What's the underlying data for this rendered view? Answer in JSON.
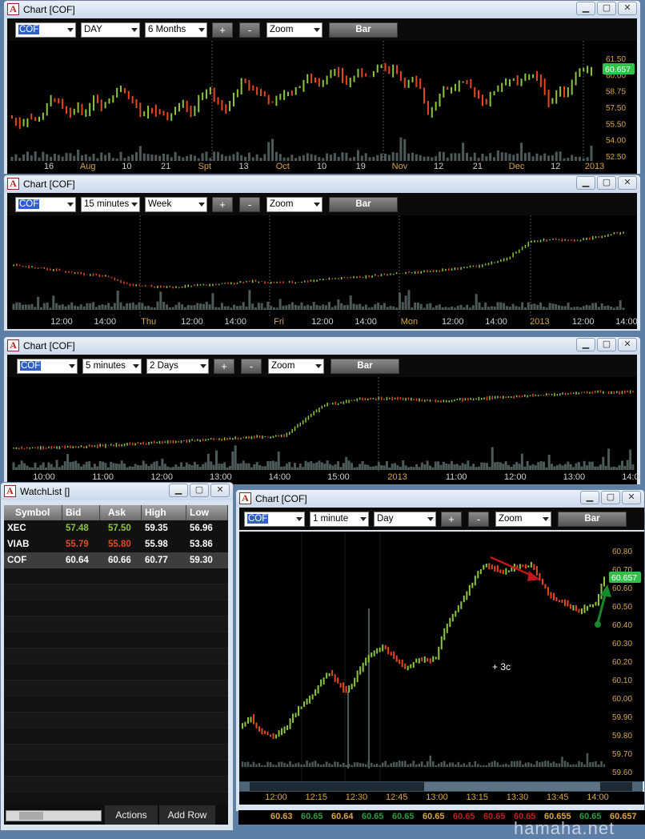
{
  "colors": {
    "up": "#8cc63f",
    "down": "#e8471e",
    "last": "#2ec24a",
    "volume": "#4c5a5a",
    "axis": "#d6a545"
  },
  "windows": [
    {
      "title": "Chart [COF]",
      "symbol": "COF",
      "interval": "DAY",
      "range": "6 Months",
      "zoom": "Zoom",
      "mode": "Bar",
      "plus": "+",
      "minus": "-",
      "ylabels": [
        "61.50",
        "60.00",
        "58.75",
        "57.50",
        "55.50",
        "54.00",
        "52.50"
      ],
      "last_price": "60.657",
      "xlabels": [
        "16",
        "Aug",
        "10",
        "21",
        "Spt",
        "13",
        "Oct",
        "10",
        "19",
        "Nov",
        "12",
        "21",
        "Dec",
        "12",
        "2013"
      ],
      "chart_data": {
        "type": "ohlc",
        "ylim": [
          51.5,
          62.5
        ],
        "close": [
          55.0,
          54.2,
          55.2,
          54.6,
          55.7,
          57.6,
          56.4,
          55.1,
          56.6,
          55.4,
          57.4,
          56.5,
          57.3,
          58.6,
          57.9,
          56.6,
          55.1,
          56.3,
          55.3,
          55.0,
          56.0,
          56.6,
          55.5,
          57.7,
          58.2,
          57.2,
          55.4,
          57.2,
          59.2,
          58.9,
          58.1,
          57.5,
          56.5,
          57.7,
          58.0,
          58.4,
          59.6,
          59.2,
          59.2,
          60.6,
          60.1,
          59.0,
          60.0,
          60.3,
          59.6,
          61.5,
          60.5,
          60.8,
          58.9,
          59.4,
          58.4,
          55.6,
          57.1,
          58.5,
          58.4,
          59.2,
          58.6,
          57.9,
          56.6,
          58.1,
          58.9,
          59.5,
          59.1,
          59.6,
          60.2,
          58.6,
          56.5,
          58.6,
          57.8,
          60.1,
          60.6,
          60.657
        ]
      }
    },
    {
      "title": "Chart [COF]",
      "symbol": "COF",
      "interval": "15 minutes",
      "range": "Week",
      "zoom": "Zoom",
      "mode": "Bar",
      "plus": "+",
      "minus": "-",
      "xlabels": [
        "12:00",
        "14:00",
        "Thu",
        "12:00",
        "14:00",
        "Fri",
        "12:00",
        "14:00",
        "Mon",
        "12:00",
        "14:00",
        "2013",
        "12:00",
        "14:00"
      ]
    },
    {
      "title": "Chart [COF]",
      "symbol": "COF",
      "interval": "5 minutes",
      "range": "2 Days",
      "zoom": "Zoom",
      "mode": "Bar",
      "plus": "+",
      "minus": "-",
      "xlabels": [
        "10:00",
        "11:00",
        "12:00",
        "13:00",
        "14:00",
        "15:00",
        "2013",
        "11:00",
        "12:00",
        "13:00",
        "14:00"
      ]
    },
    {
      "title": "Chart [COF]",
      "symbol": "COF",
      "interval": "1 minute",
      "range": "Day",
      "zoom": "Zoom",
      "mode": "Bar",
      "plus": "+",
      "minus": "-",
      "ylabels": [
        "60.80",
        "60.70",
        "60.60",
        "60.50",
        "60.40",
        "60.30",
        "60.20",
        "60.10",
        "60.00",
        "59.90",
        "59.80",
        "59.70",
        "59.60"
      ],
      "last_price": "60.657",
      "annotation": "+ 3c",
      "xlabels": [
        "12:00",
        "12:15",
        "12:30",
        "12:45",
        "13:00",
        "13:15",
        "13:30",
        "13:45",
        "14:00"
      ],
      "chart_data": {
        "type": "ohlc",
        "ylim": [
          59.55,
          60.85
        ],
        "close": [
          59.77,
          59.82,
          59.74,
          59.71,
          59.7,
          59.74,
          59.8,
          59.87,
          59.92,
          59.97,
          60.05,
          60.09,
          60.02,
          59.97,
          60.05,
          60.14,
          60.2,
          60.24,
          60.22,
          60.17,
          60.12,
          60.14,
          60.16,
          60.17,
          60.17,
          60.33,
          60.42,
          60.5,
          60.58,
          60.66,
          60.73,
          60.72,
          60.7,
          60.69,
          60.73,
          60.73,
          60.74,
          60.64,
          60.57,
          60.52,
          60.51,
          60.48,
          60.45,
          60.49,
          60.5,
          60.66
        ]
      }
    }
  ],
  "watchlist": {
    "title": "WatchList []",
    "columns": [
      "Symbol",
      "Bid",
      "Ask",
      "High",
      "Low"
    ],
    "rows": [
      {
        "symbol": "XEC",
        "bid": "57.48",
        "ask": "57.50",
        "high": "59.35",
        "low": "56.96",
        "bid_color": "#8cc63f",
        "ask_color": "#8cc63f"
      },
      {
        "symbol": "VIAB",
        "bid": "55.79",
        "ask": "55.80",
        "high": "55.98",
        "low": "53.86",
        "bid_color": "#e8471e",
        "ask_color": "#e8471e"
      },
      {
        "symbol": "COF",
        "bid": "60.64",
        "ask": "60.66",
        "high": "60.77",
        "low": "59.30",
        "bid_color": "#ffffff",
        "ask_color": "#ffffff"
      }
    ],
    "actions": "Actions",
    "add_row": "Add Row"
  },
  "tape": [
    {
      "v": "60.63",
      "c": "#d6a545"
    },
    {
      "v": "60.65",
      "c": "#2e9a3a"
    },
    {
      "v": "60.64",
      "c": "#d6a545"
    },
    {
      "v": "60.65",
      "c": "#2e9a3a"
    },
    {
      "v": "60.65",
      "c": "#2e9a3a"
    },
    {
      "v": "60.65",
      "c": "#d6a545"
    },
    {
      "v": "60.65",
      "c": "#b3261e"
    },
    {
      "v": "60.65",
      "c": "#b3261e"
    },
    {
      "v": "60.65",
      "c": "#b3261e"
    },
    {
      "v": "60.655",
      "c": "#d6a545"
    },
    {
      "v": "60.65",
      "c": "#2e9a3a"
    },
    {
      "v": "60.657",
      "c": "#d6a545"
    }
  ],
  "watermark": "hamaha.net"
}
